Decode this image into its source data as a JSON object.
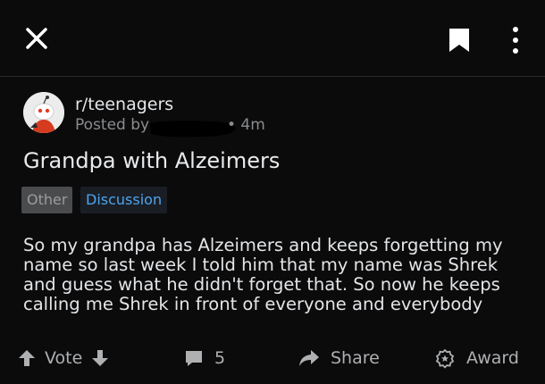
{
  "top_bar": {
    "close_icon": "close-icon",
    "bookmark_icon": "bookmark-icon",
    "more_icon": "more-vertical-icon"
  },
  "post": {
    "subreddit": "r/teenagers",
    "posted_by_label": "Posted by",
    "time": "• 4m",
    "title": "Grandpa with Alzeimers",
    "flairs": {
      "other": "Other",
      "discussion": "Discussion"
    },
    "body_lines": [
      "So my grandpa has Alzeimers and keeps forgetting my",
      "name so last week I told him that my name was Shrek",
      "and guess what he didn't forget that. So now he keeps",
      "calling me Shrek in front of everyone and everybody"
    ]
  },
  "actions": {
    "vote_label": "Vote",
    "comment_count": "5",
    "share_label": "Share",
    "award_label": "Award"
  },
  "colors": {
    "background": "#0b0b0c",
    "accent_blue": "#4ea4ee",
    "muted_text": "#8a8c8e"
  }
}
